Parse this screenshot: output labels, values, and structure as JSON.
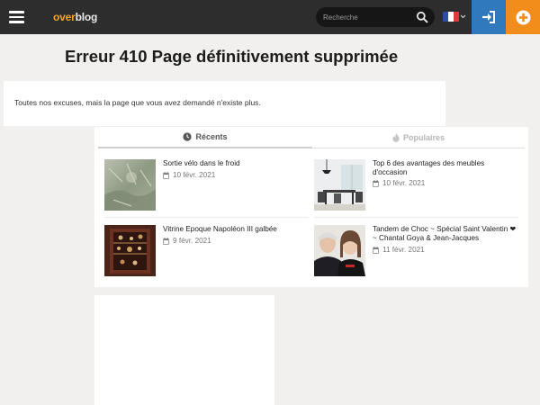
{
  "header": {
    "logo_over": "over",
    "logo_blog": "blog",
    "search_placeholder": "Recherche",
    "language": "FR",
    "brand_colors": {
      "bar": "#2d2d2d",
      "logo_accent": "#f2a52c",
      "login": "#2f79bc",
      "add": "#f28c1b"
    }
  },
  "page": {
    "title": "Erreur 410 Page définitivement supprimée",
    "message": "Toutes nos excuses, mais la page que vous avez demandé n'existe plus."
  },
  "tabs": {
    "recents": "Récents",
    "populaires": "Populaires"
  },
  "recents": [
    {
      "title": "Sortie vélo dans le froid",
      "date": "10 févr. 2021",
      "thumb": "frost-photo"
    },
    {
      "title": "Vitrine Epoque Napoléon III galbée",
      "date": "9 févr. 2021",
      "thumb": "vitrine-photo"
    }
  ],
  "populaires": [
    {
      "title": "Top 6 des avantages des meubles d'occasion",
      "date": "10 févr. 2021",
      "thumb": "dining-room-photo"
    },
    {
      "title": "Tandem de Choc ~ Spécial Saint Valentin ❤ ~ Chantal Goya & Jean-Jacques",
      "date": "11 févr. 2021",
      "thumb": "couple-photo"
    }
  ],
  "icons": {
    "menu": "hamburger-icon",
    "search": "search-icon",
    "login": "sign-in-icon",
    "add": "plus-circle-icon",
    "recents": "clock-icon",
    "populaires": "flame-icon",
    "date": "calendar-icon"
  }
}
